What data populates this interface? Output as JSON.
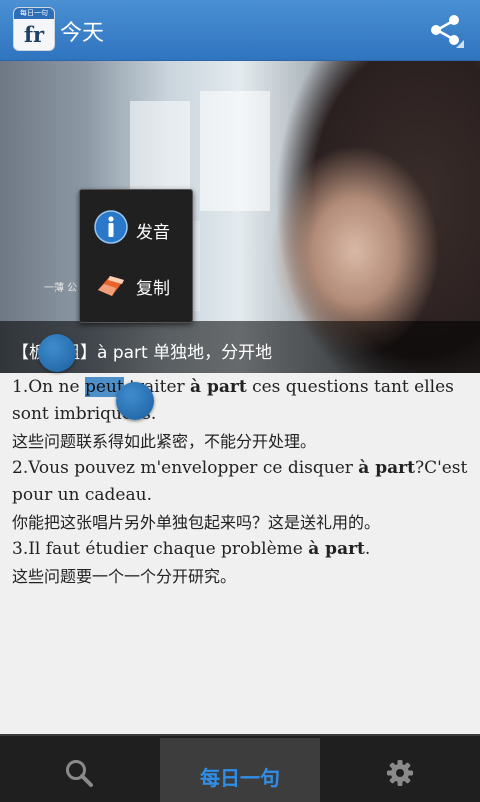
{
  "header": {
    "title": "今天",
    "app_icon_caption": "每日一句",
    "app_icon_text": "fr"
  },
  "hero": {
    "caption": "【板块组】à part 单独地，分开地",
    "small_text": "一薄 公"
  },
  "popup": {
    "items": [
      {
        "label": "发音",
        "icon": "info-icon"
      },
      {
        "label": "复制",
        "icon": "eraser-icon"
      }
    ]
  },
  "content": {
    "lines": [
      {
        "pre": "1.On ne ",
        "sel": "peut",
        "mid": " traiter ",
        "bold": "à part",
        "post": " ces questions tant elles sont imbriquées."
      },
      {
        "cn": "这些问题联系得如此紧密，不能分开处理。"
      },
      {
        "pre": "2.Vous pouvez m'envelopper ce disquer ",
        "bold": "à part",
        "post": "?C'est pour un cadeau."
      },
      {
        "cn": "你能把这张唱片另外单独包起来吗？这是送礼用的。"
      },
      {
        "pre": "3.Il faut étudier chaque problème ",
        "bold": "à part",
        "post": "."
      },
      {
        "cn": "这些问题要一个一个分开研究。"
      }
    ]
  },
  "bottom_nav": {
    "tabs": [
      {
        "label": "",
        "icon": "search-icon"
      },
      {
        "label": "每日一句",
        "icon": ""
      },
      {
        "label": "",
        "icon": "gear-icon"
      }
    ],
    "active": 1
  },
  "colors": {
    "accent": "#2f74bf",
    "selection": "#4d8fc9",
    "tab_active_text": "#2f8fe8"
  }
}
